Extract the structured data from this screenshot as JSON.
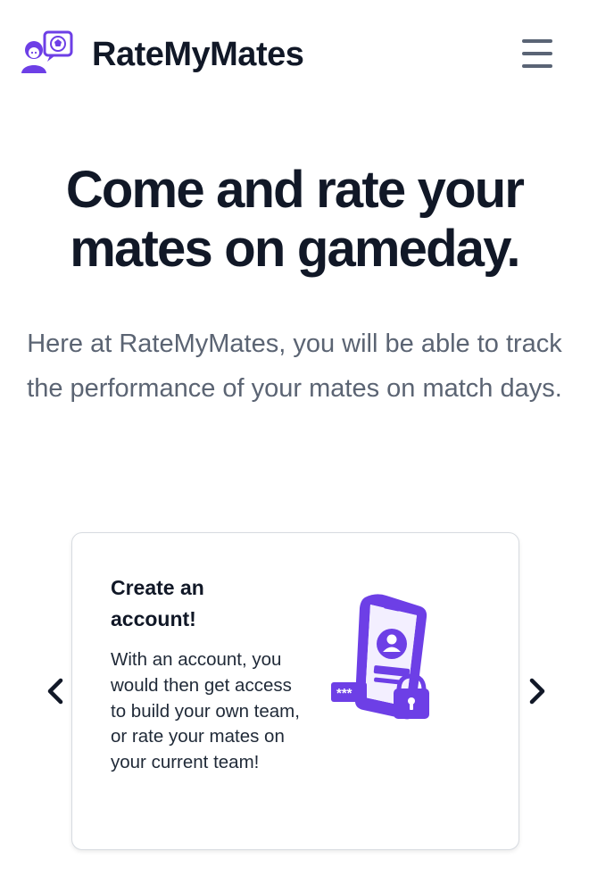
{
  "header": {
    "brand": "RateMyMates",
    "logo_icon": "user-with-soccer-speech-bubble-icon",
    "menu_icon": "hamburger-menu-icon"
  },
  "hero": {
    "title": "Come and rate your mates on gameday.",
    "subtitle": "Here at RateMyMates, you will be able to track the performance of your mates on match days."
  },
  "carousel": {
    "prev_icon": "chevron-left-icon",
    "next_icon": "chevron-right-icon",
    "card": {
      "title": "Create an account!",
      "body": "With an account, you would then get access to build your own team, or rate your mates on your current team!",
      "illustration_icon": "phone-login-lock-icon",
      "password_text": "***"
    }
  },
  "colors": {
    "brand_purple": "#6d3fe6",
    "text_dark": "#111827",
    "text_muted": "#5b6473"
  }
}
